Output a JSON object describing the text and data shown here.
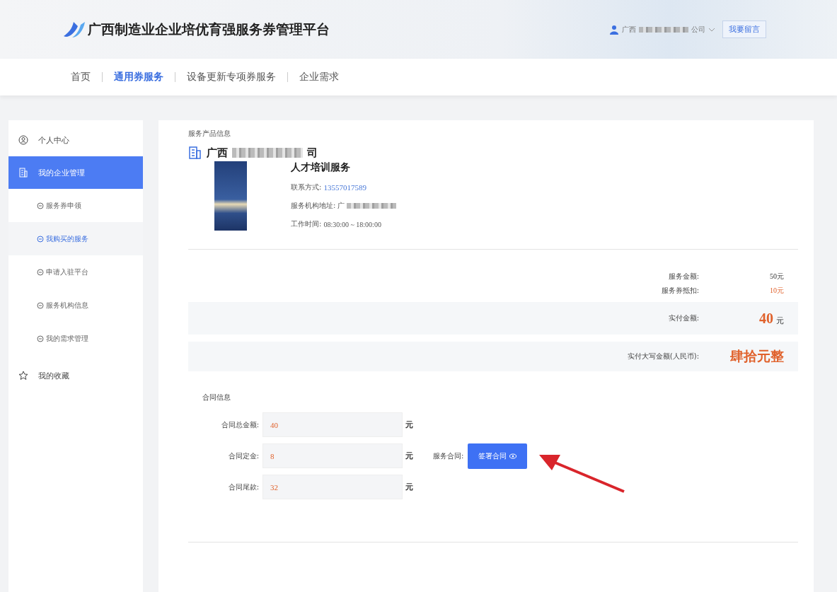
{
  "header": {
    "title": "广西制造业企业培优育强服务券管理平台",
    "user": {
      "name_start": "广西",
      "name_end": "公司"
    },
    "message_button": "我要留言"
  },
  "nav": [
    {
      "label": "首页",
      "selected": false
    },
    {
      "label": "通用券服务",
      "selected": true
    },
    {
      "label": "设备更新专项券服务",
      "selected": false
    },
    {
      "label": "企业需求",
      "selected": false
    }
  ],
  "sidebar": {
    "items": [
      {
        "label": "个人中心",
        "selected": false
      },
      {
        "label": "我的企业管理",
        "selected": true,
        "children": [
          {
            "label": "服务券申领",
            "selected": false
          },
          {
            "label": "我购买的服务",
            "selected": true
          },
          {
            "label": "申请入驻平台",
            "selected": false
          },
          {
            "label": "服务机构信息",
            "selected": false
          },
          {
            "label": "我的需求管理",
            "selected": false
          }
        ]
      },
      {
        "label": "我的收藏",
        "selected": false
      }
    ]
  },
  "product": {
    "section_title": "服务产品信息",
    "company_start": "广西",
    "company_end": "司",
    "service_name": "人才培训服务",
    "contact_label": "联系方式:",
    "contact": "13557017589",
    "address_label": "服务机构地址:",
    "address_start": "广",
    "hours_label": "工作时间:",
    "hours": "08:30:00 ~ 18:00:00"
  },
  "summary": {
    "amount_label": "服务金额:",
    "amount": "50元",
    "discount_label": "服务券抵扣:",
    "discount": "10元",
    "paid_label": "实付金额:",
    "paid": "40",
    "paid_unit": "元",
    "paid_words_label": "实付大写金额(人民币):",
    "paid_words": "肆拾元整"
  },
  "contract": {
    "section_title": "合同信息",
    "fields": [
      {
        "label": "合同总金额:",
        "value": "40",
        "unit": "元"
      },
      {
        "label": "合同定金:",
        "value": "8",
        "unit": "元"
      },
      {
        "label": "合同尾款:",
        "value": "32",
        "unit": "元"
      }
    ],
    "sign_label": "服务合同:",
    "sign_button": "签署合同"
  }
}
